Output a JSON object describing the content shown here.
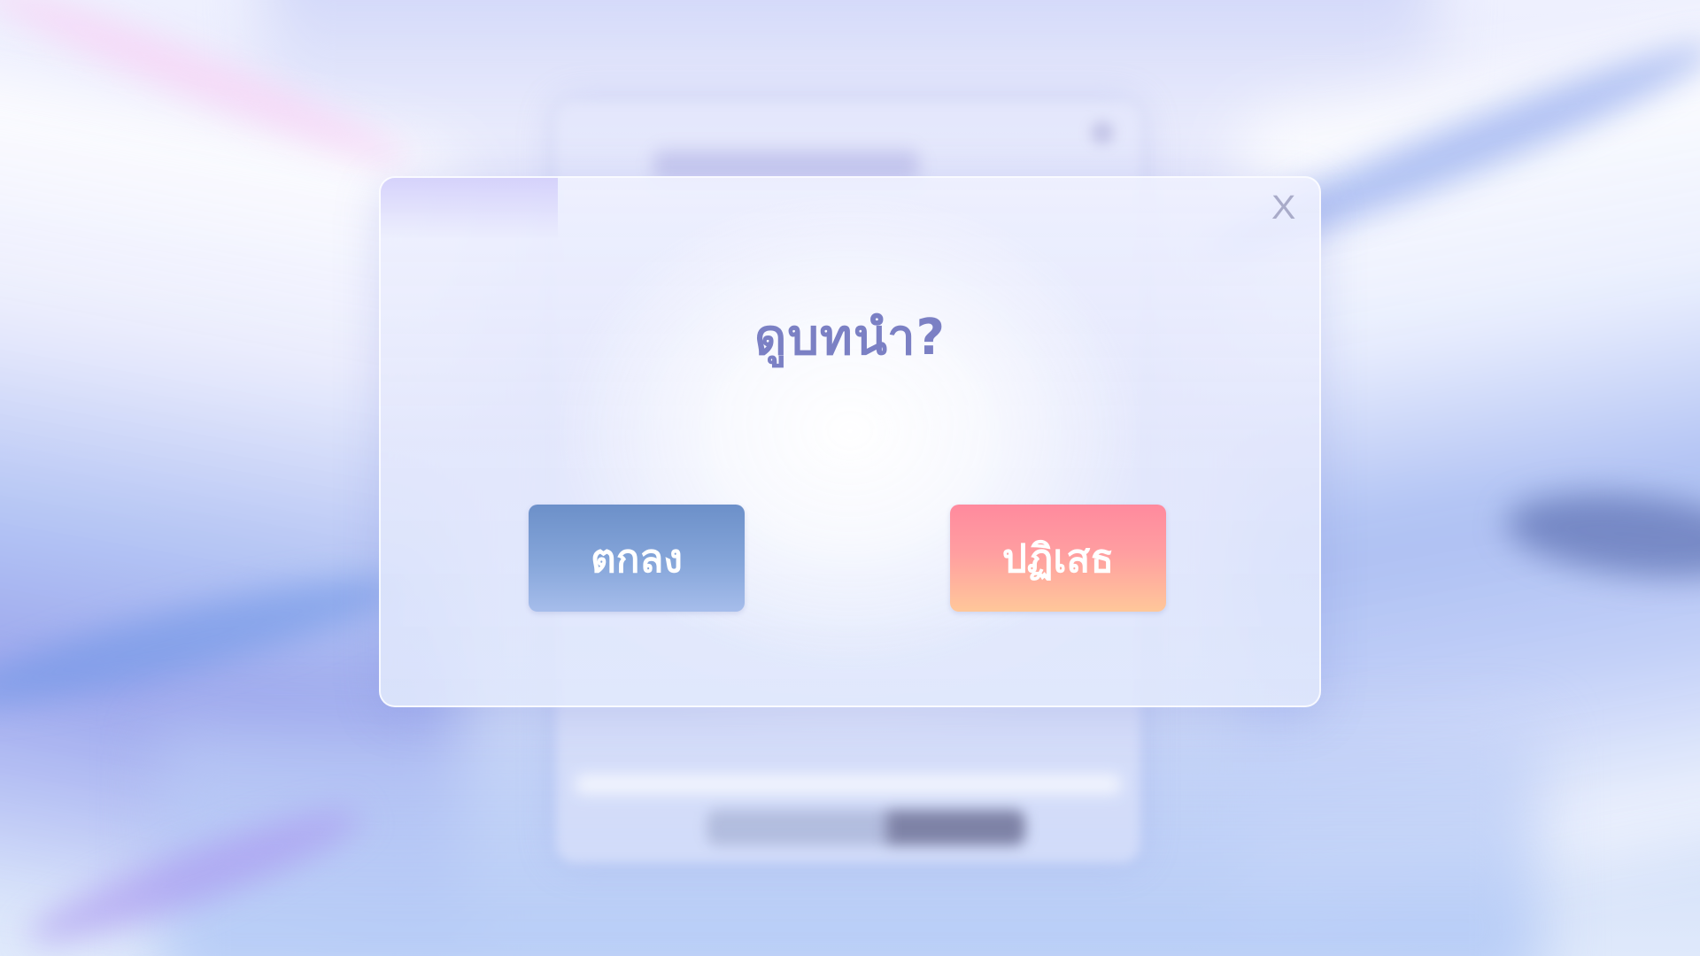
{
  "dialog": {
    "title": "ดูบทนำ?",
    "close_label": "X",
    "confirm_label": "ตกลง",
    "decline_label": "ปฏิเสธ"
  },
  "icons": {
    "close": "close-icon"
  },
  "colors": {
    "title": "#7b80c4",
    "confirm_button": "#6c90c9",
    "decline_button_top": "#ff8a9e",
    "decline_button_bottom": "#ffc79a",
    "close_icon": "#a9abc9"
  }
}
